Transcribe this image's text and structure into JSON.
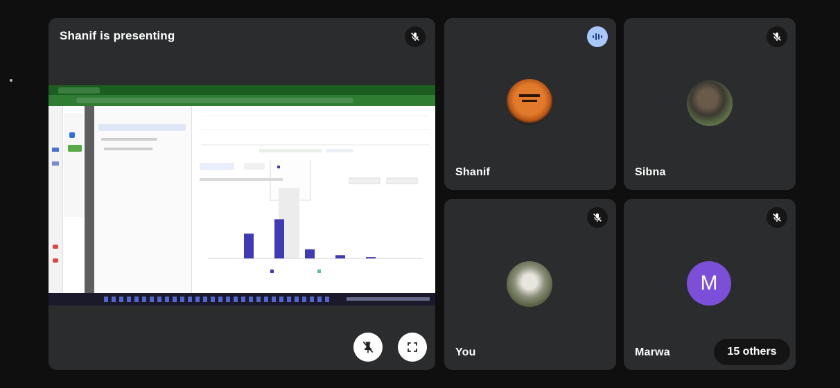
{
  "presenter_tile": {
    "title": "Shanif is presenting"
  },
  "participants": [
    {
      "name": "Shanif"
    },
    {
      "name": "Sibna"
    },
    {
      "name": "You"
    },
    {
      "name": "Marwa",
      "avatar_letter": "M"
    }
  ],
  "others_button": {
    "label": "15 others"
  },
  "colors": {
    "background": "#0f0f10",
    "tile": "#2b2c2e",
    "speaking": "#a8c7fa",
    "marwa_avatar": "#7b4fd8",
    "bars": "#3f3ab5"
  },
  "shared_chart": {
    "chart_data": {
      "type": "bar",
      "values": [
        38,
        60,
        14,
        5,
        2
      ]
    }
  }
}
